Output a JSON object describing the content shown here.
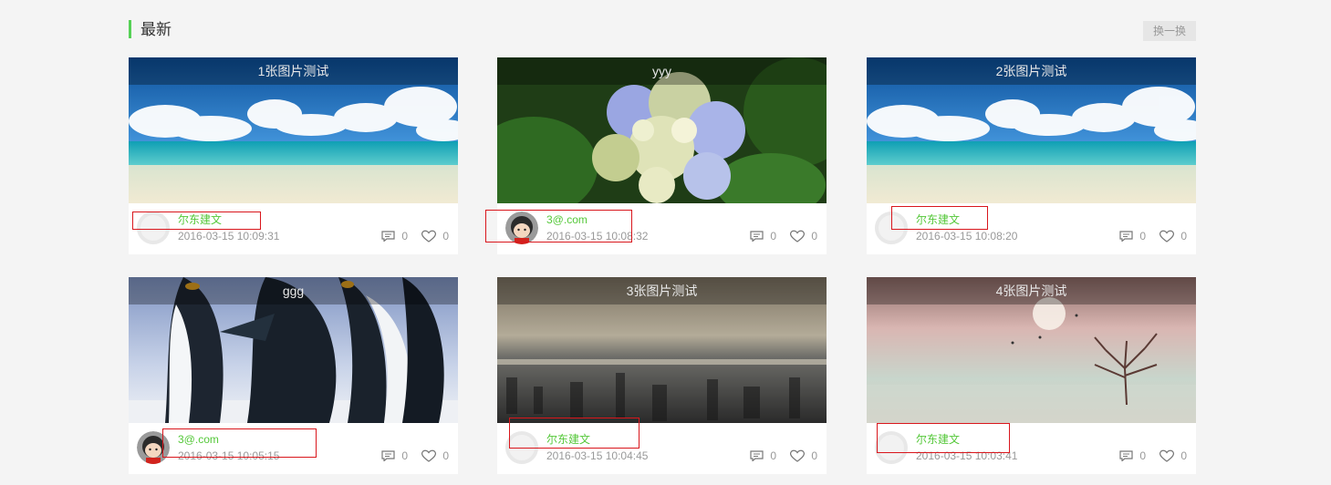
{
  "section": {
    "title": "最新",
    "swap_label": "换一换"
  },
  "cards": [
    {
      "title": "1张图片测试",
      "author": "尔东建文",
      "time": "2016-03-15 10:09:31",
      "comments": "0",
      "likes": "0"
    },
    {
      "title": "yyy",
      "author": "3@.com",
      "time": "2016-03-15 10:08:32",
      "comments": "0",
      "likes": "0"
    },
    {
      "title": "2张图片测试",
      "author": "尔东建文",
      "time": "2016-03-15 10:08:20",
      "comments": "0",
      "likes": "0"
    },
    {
      "title": "ggg",
      "author": "3@.com",
      "time": "2016-03-15 10:05:15",
      "comments": "0",
      "likes": "0"
    },
    {
      "title": "3张图片测试",
      "author": "尔东建文",
      "time": "2016-03-15 10:04:45",
      "comments": "0",
      "likes": "0"
    },
    {
      "title": "4张图片测试",
      "author": "尔东建文",
      "time": "2016-03-15 10:03:41",
      "comments": "0",
      "likes": "0"
    }
  ],
  "colors": {
    "accent": "#55d155",
    "author": "#55c83a",
    "highlight_box": "#d9161c"
  },
  "icons": {
    "comment": "comment-icon",
    "like": "heart-icon"
  }
}
